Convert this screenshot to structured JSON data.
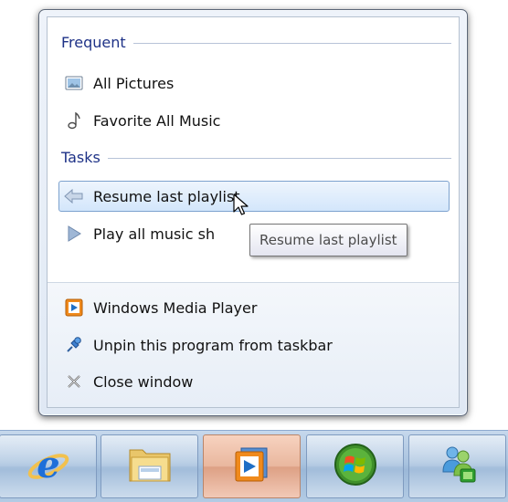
{
  "jumplist": {
    "frequent_header": "Frequent",
    "frequent_items": [
      {
        "label": "All Pictures",
        "icon": "pictures-icon"
      },
      {
        "label": "Favorite All Music",
        "icon": "music-note-icon"
      }
    ],
    "tasks_header": "Tasks",
    "task_items": [
      {
        "label": "Resume last playlist",
        "icon": "back-arrow-icon",
        "hovered": true
      },
      {
        "label": "Play all music sh",
        "icon": "play-arrow-icon"
      }
    ],
    "footer_items": [
      {
        "label": "Windows Media Player",
        "icon": "windows-media-player-icon"
      },
      {
        "label": "Unpin this program from taskbar",
        "icon": "unpin-icon"
      },
      {
        "label": "Close window",
        "icon": "close-window-icon"
      }
    ]
  },
  "tooltip": {
    "text": "Resume last playlist"
  },
  "taskbar": {
    "buttons": [
      {
        "name": "internet-explorer",
        "icon": "internet-explorer-icon"
      },
      {
        "name": "windows-explorer",
        "icon": "folder-icon"
      },
      {
        "name": "windows-media-player",
        "icon": "windows-media-player-icon",
        "active": true
      },
      {
        "name": "windows-media-center",
        "icon": "windows-logo-icon"
      },
      {
        "name": "windows-live-messenger",
        "icon": "messenger-icon"
      }
    ]
  },
  "colors": {
    "header_text": "#1e3287",
    "hover_border": "#7da2ce",
    "active_button": "#e9b79e"
  }
}
